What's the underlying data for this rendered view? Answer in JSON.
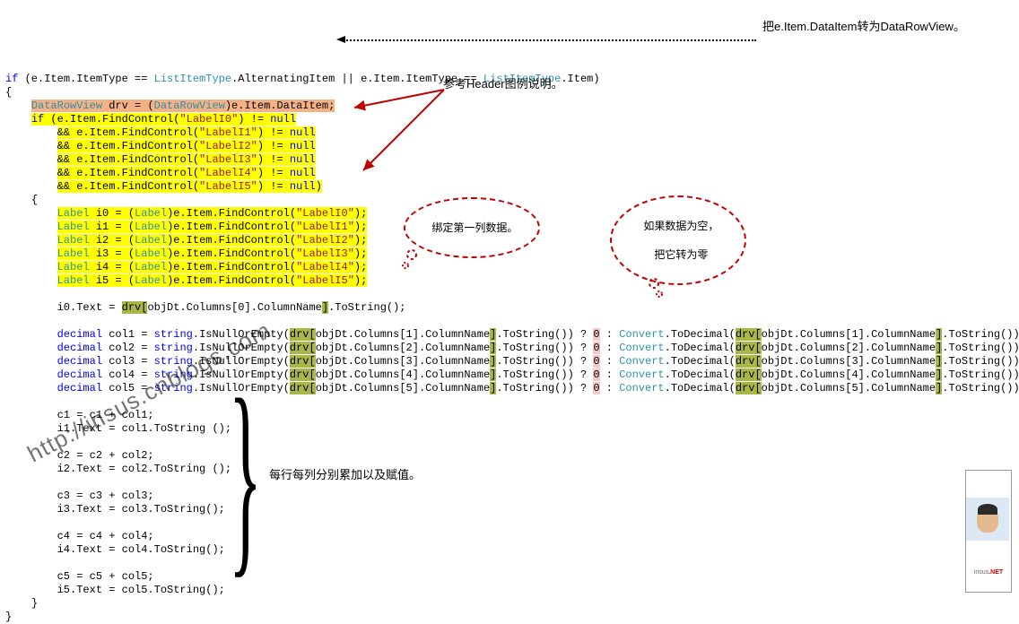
{
  "code": {
    "if_head_a": "if",
    "if_head_b": " (e.Item.ItemType == ",
    "if_head_c": "ListItemType",
    "if_head_d": ".AlternatingItem || e.Item.ItemType == ",
    "if_head_e": "ListItemType",
    "if_head_f": ".Item)",
    "brace_o": "{",
    "brace_c": "}",
    "drv_a": "DataRowView",
    "drv_b": " drv = (",
    "drv_c": "DataRowView",
    "drv_d": ")e.Item.DataItem;",
    "fc0a": "if",
    "fc0b": " (e.Item.FindControl(",
    "fc0s": "\"LabelI0\"",
    "fc0c": ") != ",
    "fc0n": "null",
    "amp": "&& ",
    "fcX": "e.Item.FindControl(",
    "fc1s": "\"LabelI1\"",
    "fc2s": "\"LabelI2\"",
    "fc3s": "\"LabelI3\"",
    "fc4s": "\"LabelI4\"",
    "fc5s": "\"LabelI5\"",
    "fcE": ") != ",
    "fcN": "null",
    "fcEp": ")",
    "lbl_a": "Label",
    "lbl_b0": " i0 = (",
    "lbl_b1": " i1 = (",
    "lbl_b2": " i2 = (",
    "lbl_b3": " i3 = (",
    "lbl_b4": " i4 = (",
    "lbl_b5": " i5 = (",
    "lbl_c": "Label",
    "lbl_d": ")e.Item.FindControl(",
    "lbl_s0": "\"LabelI0\"",
    "lbl_s1": "\"LabelI1\"",
    "lbl_s2": "\"LabelI2\"",
    "lbl_s3": "\"LabelI3\"",
    "lbl_s4": "\"LabelI4\"",
    "lbl_s5": "\"LabelI5\"",
    "lbl_e": ");",
    "i0text_a": "i0.Text = ",
    "i0text_drv": "drv[",
    "i0text_mid": "objDt.Columns[0].ColumnName",
    "i0text_end": "]",
    "i0text_ts": ".ToString();",
    "dec_kw": "decimal",
    "dec_sp": " ",
    "dec_c1": "col1 = ",
    "dec_c2": "col2 = ",
    "dec_c3": "col3 = ",
    "dec_c4": "col4 = ",
    "dec_c5": "col5 = ",
    "str_kw": "string",
    "isnull": ".IsNullOrEmpty(",
    "drv": "drv[",
    "col1": "objDt.Columns[1].ColumnName",
    "col2": "objDt.Columns[2].ColumnName",
    "col3": "objDt.Columns[3].ColumnName",
    "col4": "objDt.Columns[4].ColumnName",
    "col5": "objDt.Columns[5].ColumnName",
    "cb": "]",
    "tsp": ".ToString()) ? ",
    "zero": "0",
    "colon": " : ",
    "conv": "Convert",
    "todec": ".ToDecimal(",
    "tse": ".ToString());",
    "sum1a": "c1 = c1 + col1;",
    "sum1b": "i1.Text = col1.ToString ();",
    "sum2a": "c2 = c2 + col2;",
    "sum2b": "i2.Text = col2.ToString ();",
    "sum3a": "c3 = c3 + col3;",
    "sum3b": "i3.Text = col3.ToString();",
    "sum4a": "c4 = c4 + col4;",
    "sum4b": "i4.Text = col4.ToString();",
    "sum5a": "c5 = c5 + col5;",
    "sum5b": "i5.Text = col5.ToString();"
  },
  "ann": {
    "a1": "把e.Item.DataItem转为DataRowView。",
    "a2": "参考Header图例说明。",
    "b1": "绑定第一列数据。",
    "b2a": "如果数据为空，",
    "b2b": "把它转为零",
    "a3": "每行每列分别累加以及赋值。",
    "wm": "http://insus.cnblogs.com",
    "av": "insus",
    "avnet": ".NET"
  }
}
